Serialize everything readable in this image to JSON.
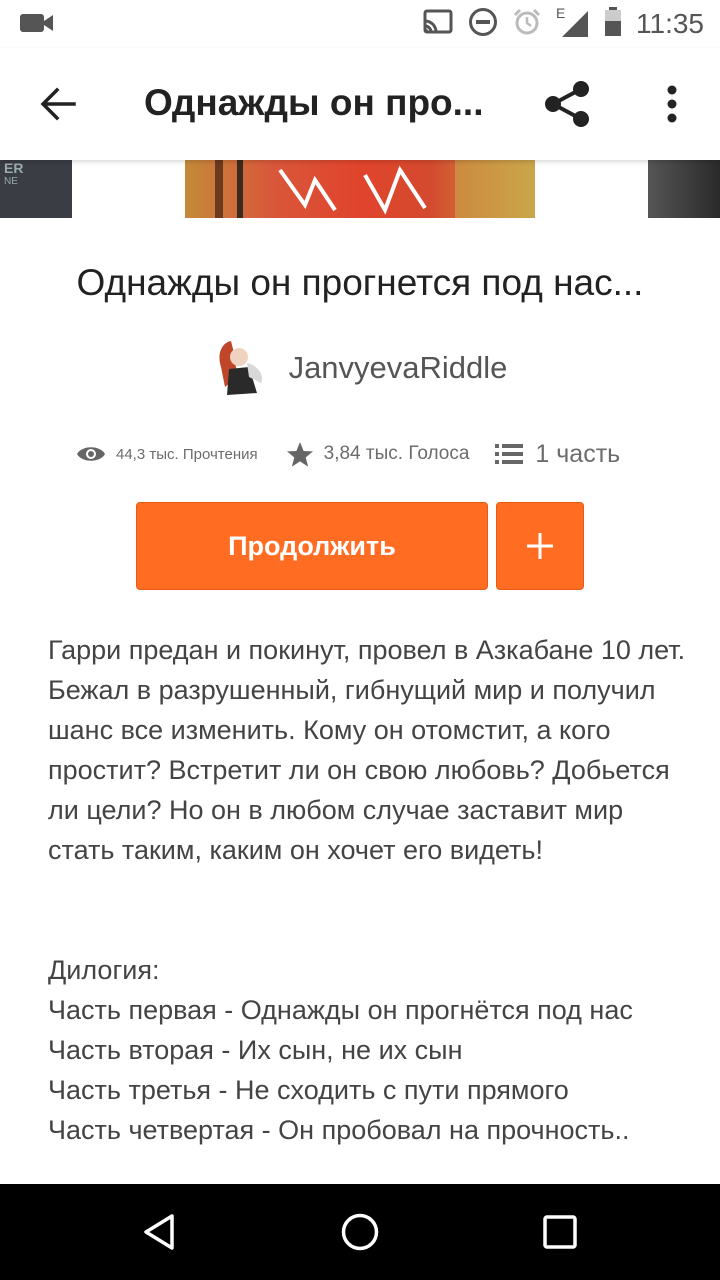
{
  "status_bar": {
    "time": "11:35",
    "network_label": "E",
    "icons": [
      "video-camera-icon",
      "cast-icon",
      "do-not-disturb-icon",
      "alarm-icon",
      "signal-icon",
      "battery-icon"
    ]
  },
  "app_bar": {
    "title": "Однажды он про...",
    "back_icon": "arrow-back-icon",
    "share_icon": "share-icon",
    "more_icon": "more-vertical-icon"
  },
  "carousel": {
    "left_cover_text": "ER",
    "left_cover_subtext": "NE"
  },
  "story": {
    "title": "Однажды он прогнется под нас...",
    "author": "JanvyevaRiddle",
    "stats": {
      "reads": "44,3 тыс. Прочтения",
      "votes": "3,84 тыс. Голоса",
      "parts": "1 часть"
    },
    "continue_label": "Продолжить",
    "add_label": "+",
    "description": "Гарри предан и покинут, провел в Азкабане 10 лет. Бежал в разрушенный, гибнущий мир и получил шанс все изменить. Кому он отомстит, а кого простит? Встретит ли он свою любовь? Добьется ли цели? Но он в любом случае заставит мир стать таким, каким он хочет его видеть!",
    "series_heading": "Дилогия:",
    "series_parts": [
      "Часть первая - Однажды он прогнётся под нас",
      "Часть вторая - Их сын, не их сын",
      "Часть третья - Не сходить с пути прямого",
      "Часть четвертая - Он пробовал на прочность.."
    ]
  },
  "colors": {
    "accent": "#ff6c22",
    "text": "#222222",
    "muted": "#6c6c6c",
    "nav_bar": "#000000"
  }
}
